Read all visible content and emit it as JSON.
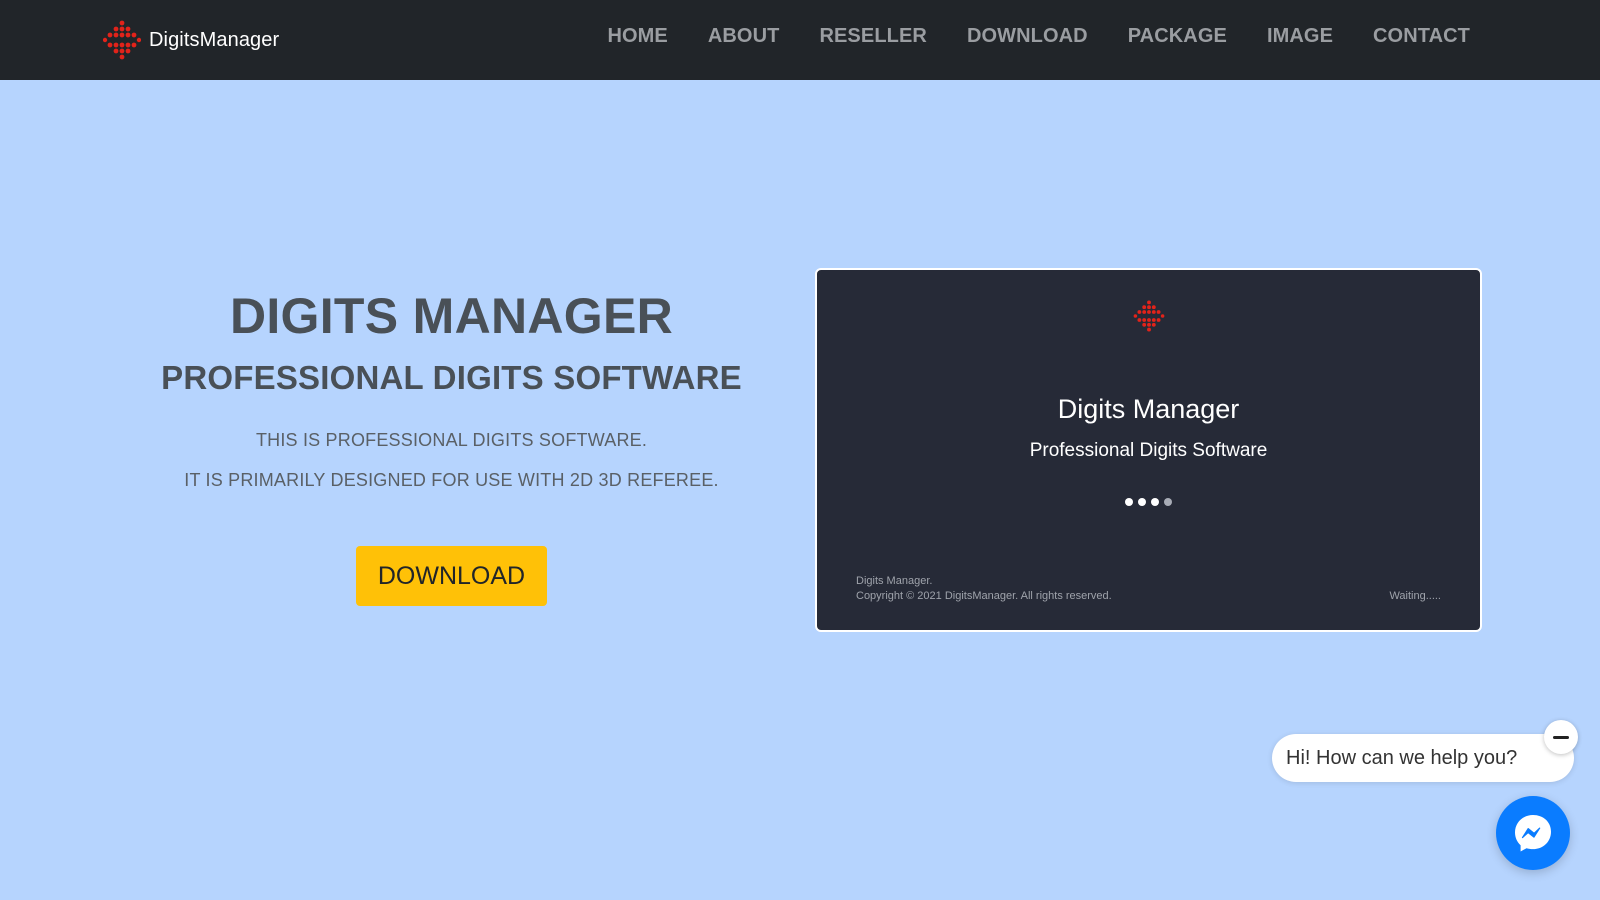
{
  "navbar": {
    "brand_name": "DigitsManager",
    "brand_icon": "red-dot-grid-logo",
    "items": [
      {
        "label": "HOME"
      },
      {
        "label": "ABOUT"
      },
      {
        "label": "RESELLER"
      },
      {
        "label": "DOWNLOAD"
      },
      {
        "label": "PACKAGE"
      },
      {
        "label": "IMAGE"
      },
      {
        "label": "CONTACT"
      }
    ]
  },
  "hero": {
    "title": "DIGITS MANAGER",
    "subtitle": "PROFESSIONAL DIGITS SOFTWARE",
    "lines": [
      "THIS IS PROFESSIONAL DIGITS SOFTWARE.",
      "IT IS PRIMARILY DESIGNED FOR USE WITH 2D 3D REFEREE."
    ],
    "button_label": "DOWNLOAD"
  },
  "splash": {
    "title": "Digits Manager",
    "subtitle": "Professional Digits Software",
    "footer_line1": "Digits Manager.",
    "footer_line2": "Copyright © 2021 DigitsManager. All rights reserved.",
    "status": "Waiting....."
  },
  "chat": {
    "greeting": "Hi! How can we help you?",
    "minimize_icon": "minus-icon",
    "messenger_icon": "messenger-icon"
  },
  "colors": {
    "navbar_bg": "#212529",
    "page_bg": "#b6d4fe",
    "accent_button": "#ffc107",
    "splash_bg": "#262a37",
    "logo_red": "#e2231a",
    "messenger_blue": "#0a7cff"
  }
}
